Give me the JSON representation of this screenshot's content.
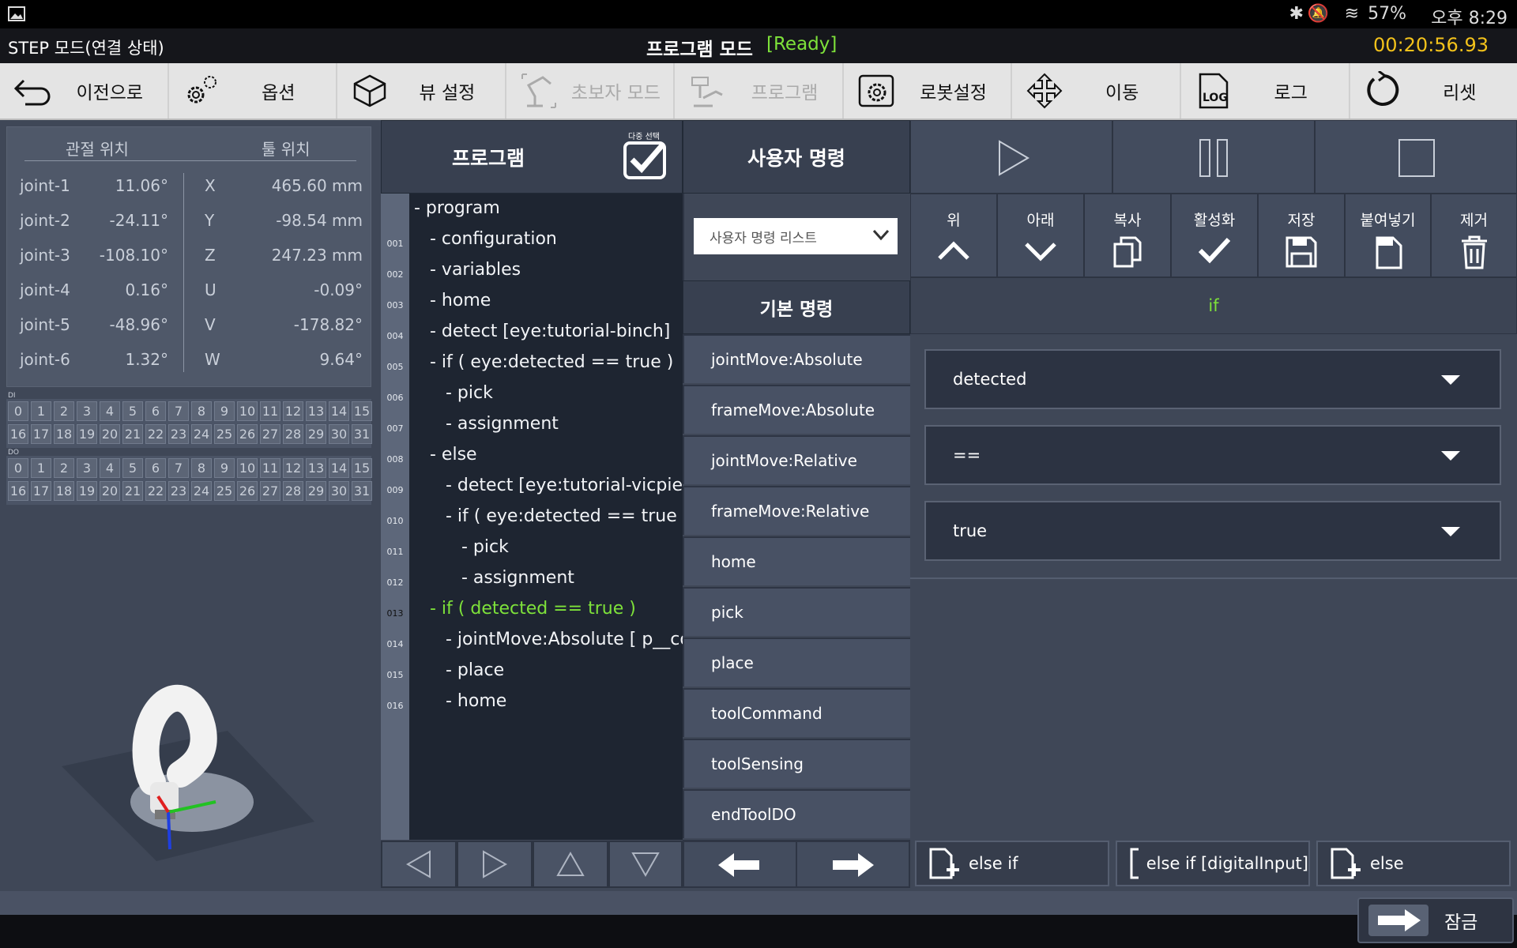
{
  "status_bar": {
    "battery": "57%",
    "time": "오후 8:29"
  },
  "title_bar": {
    "mode": "STEP 모드(연결 상태)",
    "program_mode": "프로그램 모드",
    "ready": "[Ready]",
    "timer": "00:20:56.93"
  },
  "toolbar": [
    {
      "label": "이전으로",
      "icon": "back-arrow-icon",
      "enabled": true
    },
    {
      "label": "옵션",
      "icon": "gears-icon",
      "enabled": true
    },
    {
      "label": "뷰 설정",
      "icon": "cube-icon",
      "enabled": true
    },
    {
      "label": "초보자 모드",
      "icon": "robot-arm-icon",
      "enabled": false
    },
    {
      "label": "프로그램",
      "icon": "robot-program-icon",
      "enabled": false
    },
    {
      "label": "로봇설정",
      "icon": "robot-settings-icon",
      "enabled": true
    },
    {
      "label": "이동",
      "icon": "move-arrows-icon",
      "enabled": true
    },
    {
      "label": "로그",
      "icon": "log-icon",
      "enabled": true
    },
    {
      "label": "리셋",
      "icon": "reset-icon",
      "enabled": true
    }
  ],
  "positions": {
    "joint_header": "관절 위치",
    "tool_header": "툴 위치",
    "joints": [
      {
        "name": "joint-1",
        "value": "11.06°"
      },
      {
        "name": "joint-2",
        "value": "-24.11°"
      },
      {
        "name": "joint-3",
        "value": "-108.10°"
      },
      {
        "name": "joint-4",
        "value": "0.16°"
      },
      {
        "name": "joint-5",
        "value": "-48.96°"
      },
      {
        "name": "joint-6",
        "value": "1.32°"
      }
    ],
    "tools": [
      {
        "axis": "X",
        "value": "465.60 mm"
      },
      {
        "axis": "Y",
        "value": "-98.54 mm"
      },
      {
        "axis": "Z",
        "value": "247.23 mm"
      },
      {
        "axis": "U",
        "value": "-0.09°"
      },
      {
        "axis": "V",
        "value": "-178.82°"
      },
      {
        "axis": "W",
        "value": "9.64°"
      }
    ]
  },
  "io": {
    "di_label": "DI",
    "do_label": "DO",
    "numbers": [
      "0",
      "1",
      "2",
      "3",
      "4",
      "5",
      "6",
      "7",
      "8",
      "9",
      "10",
      "11",
      "12",
      "13",
      "14",
      "15",
      "16",
      "17",
      "18",
      "19",
      "20",
      "21",
      "22",
      "23",
      "24",
      "25",
      "26",
      "27",
      "28",
      "29",
      "30",
      "31"
    ]
  },
  "program": {
    "title": "프로그램",
    "multi_select": "다중 선택",
    "root": "- program",
    "lines": [
      {
        "no": "001",
        "text": "- configuration",
        "indent": 1
      },
      {
        "no": "002",
        "text": "- variables",
        "indent": 1
      },
      {
        "no": "003",
        "text": "- home",
        "indent": 1
      },
      {
        "no": "004",
        "text": "- detect [eye:tutorial-binch]",
        "indent": 1
      },
      {
        "no": "005",
        "text": "- if ( eye:detected == true )",
        "indent": 1
      },
      {
        "no": "006",
        "text": "- pick",
        "indent": 2
      },
      {
        "no": "007",
        "text": "- assignment",
        "indent": 2
      },
      {
        "no": "008",
        "text": "- else",
        "indent": 1
      },
      {
        "no": "009",
        "text": "- detect [eye:tutorial-vicpie]",
        "indent": 2
      },
      {
        "no": "010",
        "text": "- if ( eye:detected == true )",
        "indent": 2
      },
      {
        "no": "011",
        "text": "- pick",
        "indent": 3
      },
      {
        "no": "012",
        "text": "- assignment",
        "indent": 3
      },
      {
        "no": "013",
        "text": "- if ( detected == true )",
        "indent": 1,
        "selected": true
      },
      {
        "no": "014",
        "text": "- jointMove:Absolute [ p__copy",
        "indent": 2
      },
      {
        "no": "015",
        "text": "- place",
        "indent": 2
      },
      {
        "no": "016",
        "text": "- home",
        "indent": 2
      }
    ]
  },
  "commands": {
    "user_title": "사용자 명령",
    "user_list": "사용자 명령 리스트",
    "basic_title": "기본 명령",
    "items": [
      "jointMove:Absolute",
      "frameMove:Absolute",
      "jointMove:Relative",
      "frameMove:Relative",
      "home",
      "pick",
      "place",
      "toolCommand",
      "toolSensing",
      "endToolDO"
    ]
  },
  "actions": [
    {
      "label": "위",
      "icon": "chevron-up-icon"
    },
    {
      "label": "아래",
      "icon": "chevron-down-icon"
    },
    {
      "label": "복사",
      "icon": "copy-icon"
    },
    {
      "label": "활성화",
      "icon": "check-icon"
    },
    {
      "label": "저장",
      "icon": "save-icon"
    },
    {
      "label": "붙여넣기",
      "icon": "paste-icon"
    },
    {
      "label": "제거",
      "icon": "trash-icon"
    }
  ],
  "editor": {
    "command": "if",
    "fields": [
      "detected",
      "==",
      "true"
    ],
    "buttons": [
      "else if",
      "else if [digitalInput]",
      "else"
    ]
  },
  "lock_label": "잠금",
  "colors": {
    "accent_green": "#7ee23a",
    "timer_yellow": "#f3c21b",
    "panel_bg": "#3f4757"
  }
}
